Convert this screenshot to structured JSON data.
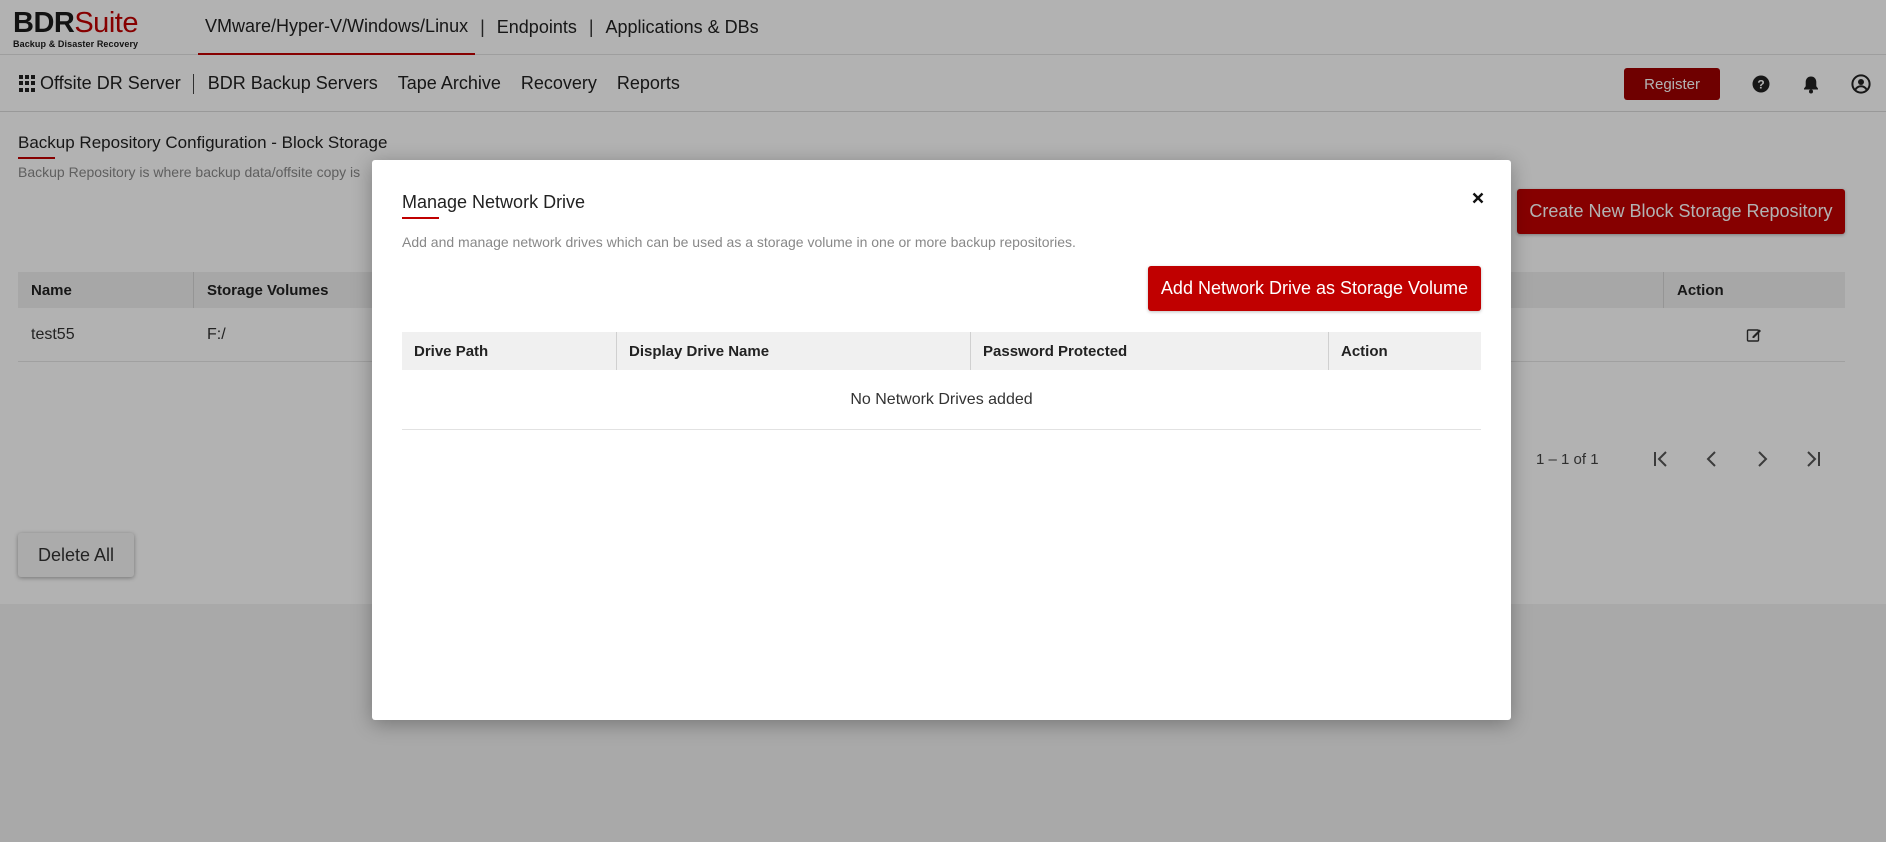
{
  "brand": {
    "name_part1": "BDR",
    "name_part2": "Suite",
    "tagline": "Backup & Disaster Recovery",
    "accent_color": "#c00000"
  },
  "product_tabs": [
    {
      "label": "VMware/Hyper-V/Windows/Linux",
      "active": true
    },
    {
      "label": "Endpoints",
      "active": false
    },
    {
      "label": "Applications & DBs",
      "active": false
    }
  ],
  "tab_separator": "|",
  "navbar": {
    "apps_icon": "grid-icon",
    "items": [
      {
        "label": "Offsite DR Server"
      },
      {
        "label": "BDR Backup Servers"
      },
      {
        "label": "Tape Archive"
      },
      {
        "label": "Recovery"
      },
      {
        "label": "Reports"
      }
    ],
    "register_label": "Register",
    "icons": [
      "help-icon",
      "bell-icon",
      "user-icon"
    ]
  },
  "page": {
    "title": "Backup Repository Configuration - Block Storage",
    "subtitle": "Backup Repository is where backup data/offsite copy is",
    "create_button": "Create New Block Storage Repository",
    "table": {
      "columns": [
        "Name",
        "Storage Volumes",
        "Action"
      ],
      "rows": [
        {
          "name": "test55",
          "storage_volumes": "F:/",
          "action_icon": "edit-icon"
        }
      ]
    },
    "pagination": "1 – 1 of 1",
    "delete_all_label": "Delete All"
  },
  "modal": {
    "title": "Manage Network Drive",
    "description": "Add and manage network drives which can be used as a storage volume in one or more backup repositories.",
    "add_button": "Add Network Drive as Storage Volume",
    "close_icon": "close-icon",
    "table": {
      "columns": [
        "Drive Path",
        "Display Drive Name",
        "Password Protected",
        "Action"
      ],
      "empty_message": "No Network Drives added"
    }
  }
}
